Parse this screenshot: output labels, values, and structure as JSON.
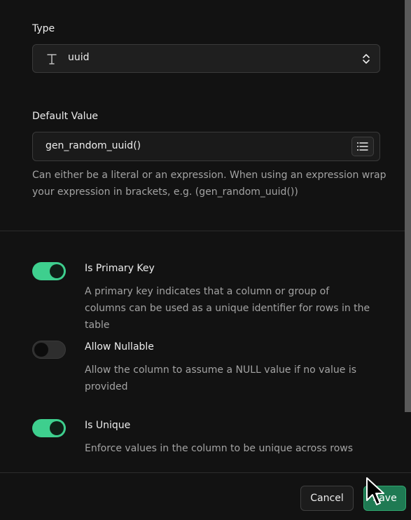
{
  "type_field": {
    "label": "Type",
    "value": "uuid",
    "icon": "text-type-icon"
  },
  "default_value_field": {
    "label": "Default Value",
    "value": "gen_random_uuid()",
    "help": "Can either be a literal or an expression. When using an expression wrap your expression in brackets, e.g. (gen_random_uuid())",
    "icon": "list-icon"
  },
  "options": [
    {
      "title": "Is Primary Key",
      "description": "A primary key indicates that a column or group of columns can be used as a unique identifier for rows in the table",
      "enabled": true
    },
    {
      "title": "Allow Nullable",
      "description": "Allow the column to assume a NULL value if no value is provided",
      "enabled": false
    },
    {
      "title": "Is Unique",
      "description": "Enforce values in the column to be unique across rows",
      "enabled": true
    }
  ],
  "footer": {
    "cancel_label": "Cancel",
    "save_label": "Save"
  },
  "colors": {
    "accent": "#3ecf8e",
    "background": "#121212",
    "save_button": "#1f7a53"
  }
}
